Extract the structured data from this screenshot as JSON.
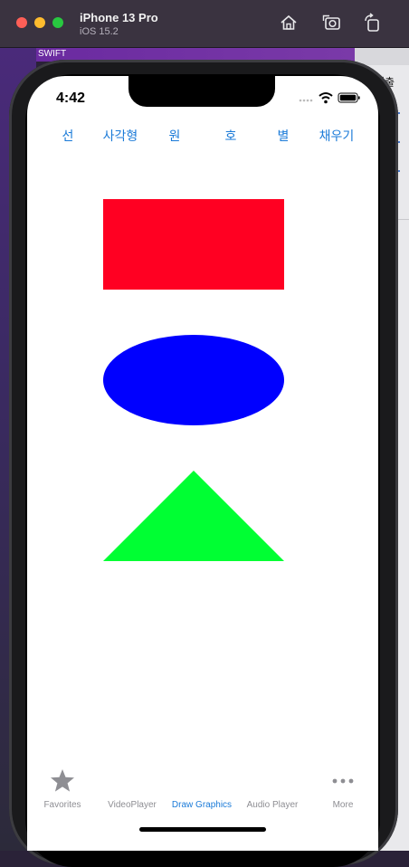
{
  "simulator": {
    "device_name": "iPhone 13 Pro",
    "os_version": "iOS 15.2",
    "toolbar_icons": [
      "home-icon",
      "screenshot-icon",
      "rotate-icon"
    ]
  },
  "desktop": {
    "top_tag": "SWIFT",
    "right_text": "제출"
  },
  "status_bar": {
    "time": "4:42",
    "icons": [
      "signal-icon",
      "wifi-icon",
      "battery-icon"
    ]
  },
  "toolbar": {
    "buttons": [
      {
        "label": "선"
      },
      {
        "label": "사각형"
      },
      {
        "label": "원"
      },
      {
        "label": "호"
      },
      {
        "label": "별"
      },
      {
        "label": "채우기"
      }
    ]
  },
  "canvas": {
    "shapes": [
      {
        "kind": "rectangle",
        "fill": "#ff0022"
      },
      {
        "kind": "ellipse",
        "fill": "#0000ff"
      },
      {
        "kind": "triangle",
        "fill": "#00ff33"
      }
    ]
  },
  "tab_bar": {
    "tabs": [
      {
        "label": "Favorites",
        "icon": "star-icon",
        "active": false
      },
      {
        "label": "VideoPlayer",
        "icon": "",
        "active": false
      },
      {
        "label": "Draw Graphics",
        "icon": "",
        "active": true
      },
      {
        "label": "Audio Player",
        "icon": "",
        "active": false
      },
      {
        "label": "More",
        "icon": "more-icon",
        "active": false
      }
    ],
    "active_color": "#1a7ad8",
    "inactive_color": "#8e8e93"
  },
  "colors": {
    "accent": "#1a7ad8"
  }
}
